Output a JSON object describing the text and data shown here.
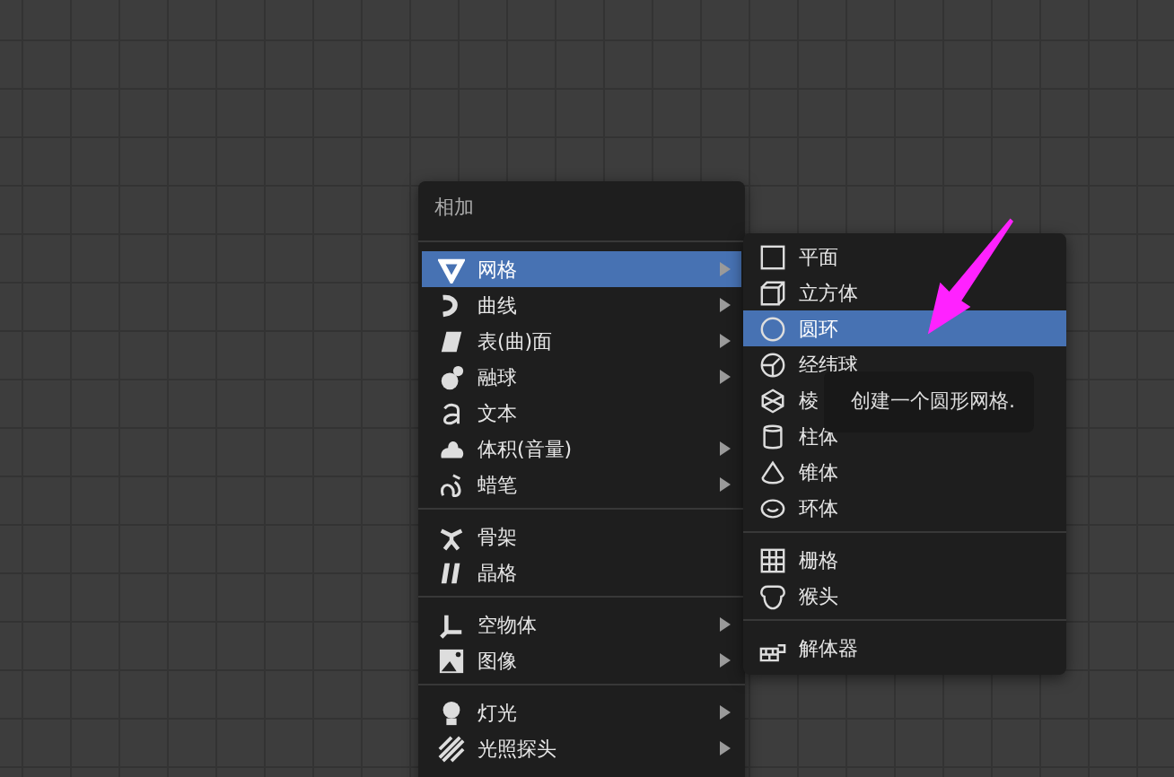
{
  "add_menu": {
    "title": "相加",
    "groups": [
      [
        {
          "label": "网格",
          "submenu": true,
          "selected": true
        },
        {
          "label": "曲线",
          "submenu": true,
          "selected": false
        },
        {
          "label": "表(曲)面",
          "submenu": true,
          "selected": false
        },
        {
          "label": "融球",
          "submenu": true,
          "selected": false
        },
        {
          "label": "文本",
          "submenu": false,
          "selected": false
        },
        {
          "label": "体积(音量)",
          "submenu": true,
          "selected": false
        },
        {
          "label": "蜡笔",
          "submenu": true,
          "selected": false
        }
      ],
      [
        {
          "label": "骨架",
          "submenu": false,
          "selected": false
        },
        {
          "label": "晶格",
          "submenu": false,
          "selected": false
        }
      ],
      [
        {
          "label": "空物体",
          "submenu": true,
          "selected": false
        },
        {
          "label": "图像",
          "submenu": true,
          "selected": false
        }
      ],
      [
        {
          "label": "灯光",
          "submenu": true,
          "selected": false
        },
        {
          "label": "光照探头",
          "submenu": true,
          "selected": false
        }
      ]
    ]
  },
  "mesh_menu": {
    "groups": [
      [
        {
          "label": "平面",
          "selected": false
        },
        {
          "label": "立方体",
          "selected": false
        },
        {
          "label": "圆环",
          "selected": true
        },
        {
          "label": "经纬球",
          "selected": false
        },
        {
          "label": "棱",
          "selected": false
        },
        {
          "label": "柱体",
          "selected": false
        },
        {
          "label": "锥体",
          "selected": false
        },
        {
          "label": "环体",
          "selected": false
        }
      ],
      [
        {
          "label": "栅格",
          "selected": false
        },
        {
          "label": "猴头",
          "selected": false
        }
      ],
      [
        {
          "label": "解体器",
          "selected": false
        }
      ]
    ]
  },
  "tooltip": {
    "text": "创建一个圆形网格."
  }
}
